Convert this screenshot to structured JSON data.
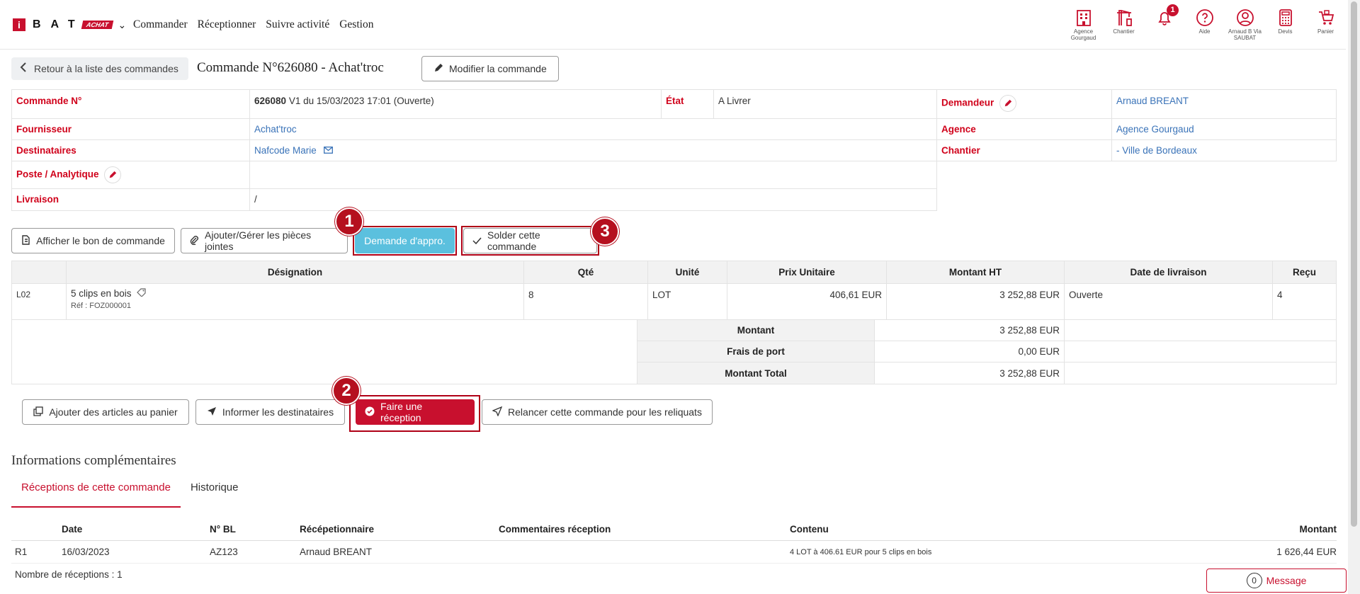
{
  "brand": {
    "logo_letter": "i",
    "logo_text": "BAT",
    "logo_badge": "ACHAT"
  },
  "nav": {
    "items": [
      "Commander",
      "Réceptionner",
      "Suivre activité",
      "Gestion"
    ]
  },
  "top_icons": [
    {
      "icon": "building-icon",
      "label": "Agence Gourgaud"
    },
    {
      "icon": "crane-icon",
      "label": "Chantier"
    },
    {
      "icon": "bell-icon",
      "label": "",
      "badge": "1"
    },
    {
      "icon": "help-icon",
      "label": "Aide"
    },
    {
      "icon": "user-icon",
      "label": "Arnaud B Via SAUBAT"
    },
    {
      "icon": "calculator-icon",
      "label": "Devis"
    },
    {
      "icon": "cart-icon",
      "label": "Panier"
    }
  ],
  "header": {
    "back_label": "Retour à la liste des commandes",
    "title": "Commande N°626080 - Achat'troc",
    "edit_label": "Modifier la commande"
  },
  "info": {
    "order_label": "Commande N°",
    "order_number": "626080",
    "order_detail": "V1 du 15/03/2023 17:01 (Ouverte)",
    "state_label": "État",
    "state_value": "A Livrer",
    "requester_label": "Demandeur",
    "requester_value": "Arnaud BREANT",
    "supplier_label": "Fournisseur",
    "supplier_value": "Achat'troc",
    "agency_label": "Agence",
    "agency_value": "Agence Gourgaud",
    "recipients_label": "Destinataires",
    "recipients_value": "Nafcode Marie",
    "site_label": "Chantier",
    "site_value": "- Ville de Bordeaux",
    "post_label": "Poste / Analytique",
    "delivery_label": "Livraison",
    "delivery_value": "/"
  },
  "actions_top": {
    "show_po": "Afficher le bon de commande",
    "attachments": "Ajouter/Gérer les pièces jointes",
    "supply_request": "Demande d'appro.",
    "close_order": "Solder cette commande"
  },
  "markers": [
    "1",
    "2",
    "3"
  ],
  "lines": {
    "headers": [
      "Désignation",
      "Qté",
      "Unité",
      "Prix Unitaire",
      "Montant HT",
      "Date de livraison",
      "Reçu"
    ],
    "rows": [
      {
        "code": "L02",
        "designation": "5 clips en bois",
        "ref": "Réf : FOZ000001",
        "qty": "8",
        "unit": "LOT",
        "unit_price": "406,61 EUR",
        "amount": "3 252,88 EUR",
        "delivery": "Ouverte",
        "received": "4"
      }
    ],
    "totals": [
      {
        "label": "Montant",
        "value": "3 252,88 EUR"
      },
      {
        "label": "Frais de port",
        "value": "0,00 EUR"
      },
      {
        "label": "Montant Total",
        "value": "3 252,88 EUR"
      }
    ]
  },
  "actions_bottom": {
    "add_to_cart": "Ajouter des articles au panier",
    "inform": "Informer les destinataires",
    "reception": "Faire une réception",
    "remind": "Relancer cette commande pour les reliquats"
  },
  "complementary": {
    "title": "Informations complémentaires",
    "tabs": [
      "Réceptions de cette commande",
      "Historique"
    ],
    "headers": [
      "Date",
      "N° BL",
      "Récépetionnaire",
      "Commentaires réception",
      "Contenu",
      "Montant"
    ],
    "rows": [
      {
        "id": "R1",
        "date": "16/03/2023",
        "bl": "AZ123",
        "receiver": "Arnaud BREANT",
        "comment": "",
        "content": "4 LOT à 406.61 EUR pour 5 clips en bois",
        "amount": "1 626,44 EUR"
      }
    ],
    "count_label": "Nombre de réceptions : 1"
  },
  "message": {
    "count": "0",
    "label": "Message"
  }
}
